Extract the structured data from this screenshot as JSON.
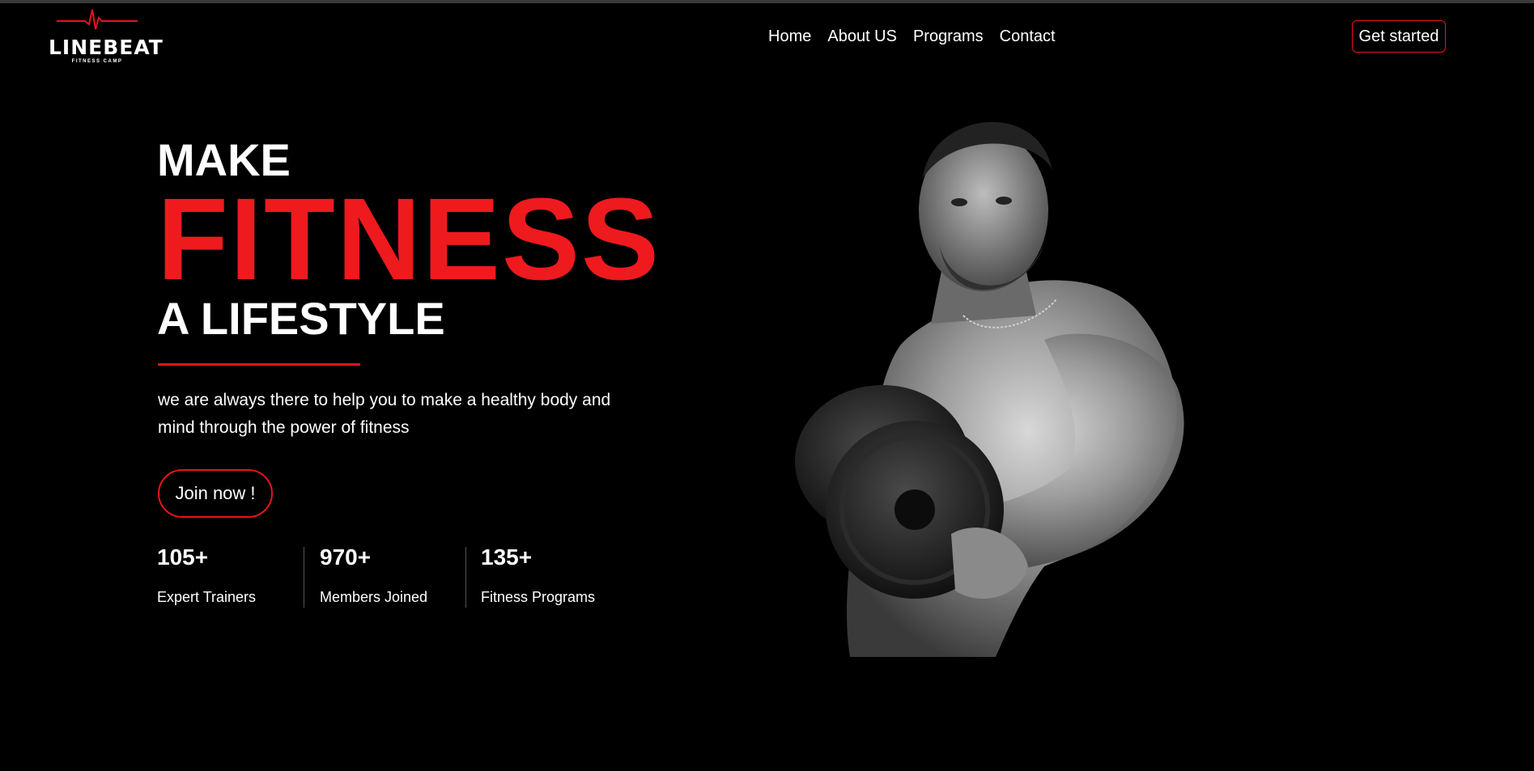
{
  "logo": {
    "brand": "LINEBEAT",
    "tagline": "FITNESS CAMP",
    "accent_color": "#e8131c"
  },
  "nav": {
    "items": [
      {
        "label": "Home"
      },
      {
        "label": "About US"
      },
      {
        "label": "Programs"
      },
      {
        "label": "Contact"
      }
    ],
    "cta_label": "Get started"
  },
  "hero": {
    "line1": "MAKE",
    "line2": "FITNESS",
    "line3": "A LIFESTYLE",
    "highlight_color": "#ee1a1e",
    "description": "we are always there to help you to make a healthy body and mind through the power of fitness",
    "join_label": "Join now !",
    "image_icon": "bodybuilder-with-dumbbell-photo"
  },
  "stats": [
    {
      "number": "105+",
      "label": "Expert Trainers"
    },
    {
      "number": "970+",
      "label": "Members Joined"
    },
    {
      "number": "135+",
      "label": "Fitness Programs"
    }
  ]
}
